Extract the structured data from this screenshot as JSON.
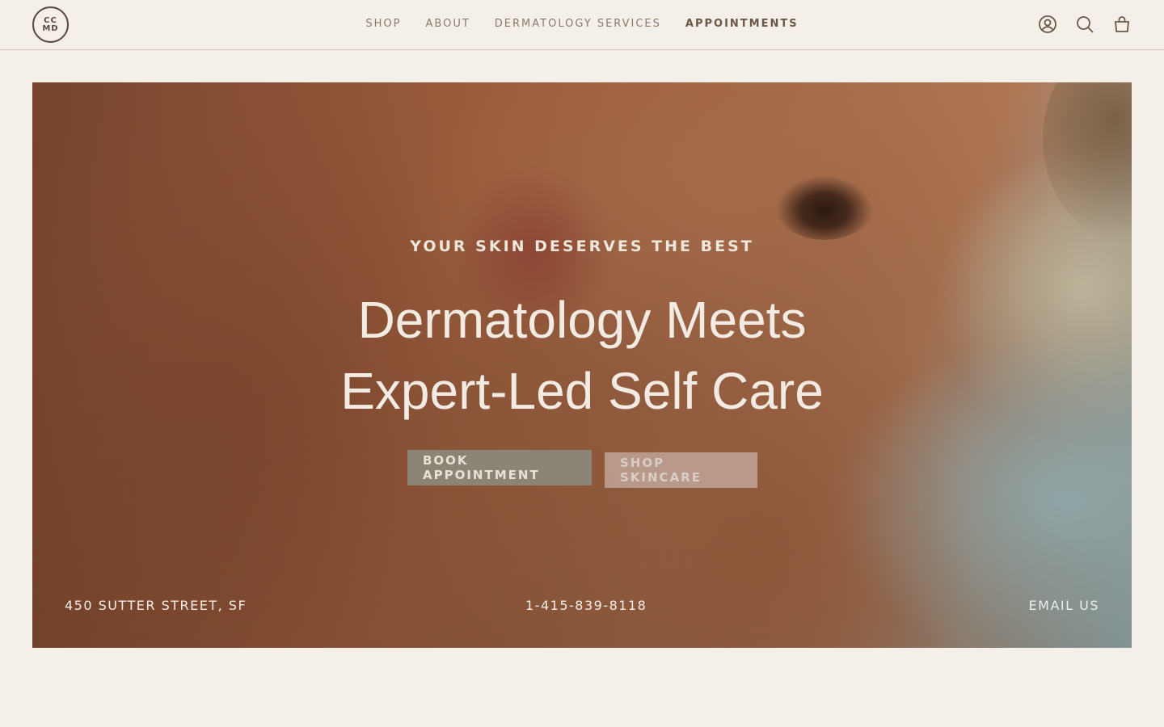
{
  "header": {
    "logo": {
      "line1": "CC",
      "line2": "MD"
    },
    "nav": [
      {
        "label": "SHOP"
      },
      {
        "label": "ABOUT"
      },
      {
        "label": "DERMATOLOGY SERVICES"
      },
      {
        "label": "APPOINTMENTS"
      }
    ],
    "icons": [
      "account-icon",
      "search-icon",
      "cart-icon"
    ]
  },
  "hero": {
    "eyebrow": "YOUR SKIN DESERVES THE BEST",
    "headline_line1": "Dermatology Meets",
    "headline_line2": "Expert-Led Self Care",
    "primary_button": "BOOK APPOINTMENT",
    "secondary_button": "SHOP SKINCARE",
    "address": "450 SUTTER STREET, SF",
    "phone": "1-415-839-8118",
    "email_link": "EMAIL US"
  },
  "colors": {
    "background": "#f4efe8",
    "text": "#5b4a3e",
    "nav_active": "#6b5848"
  }
}
